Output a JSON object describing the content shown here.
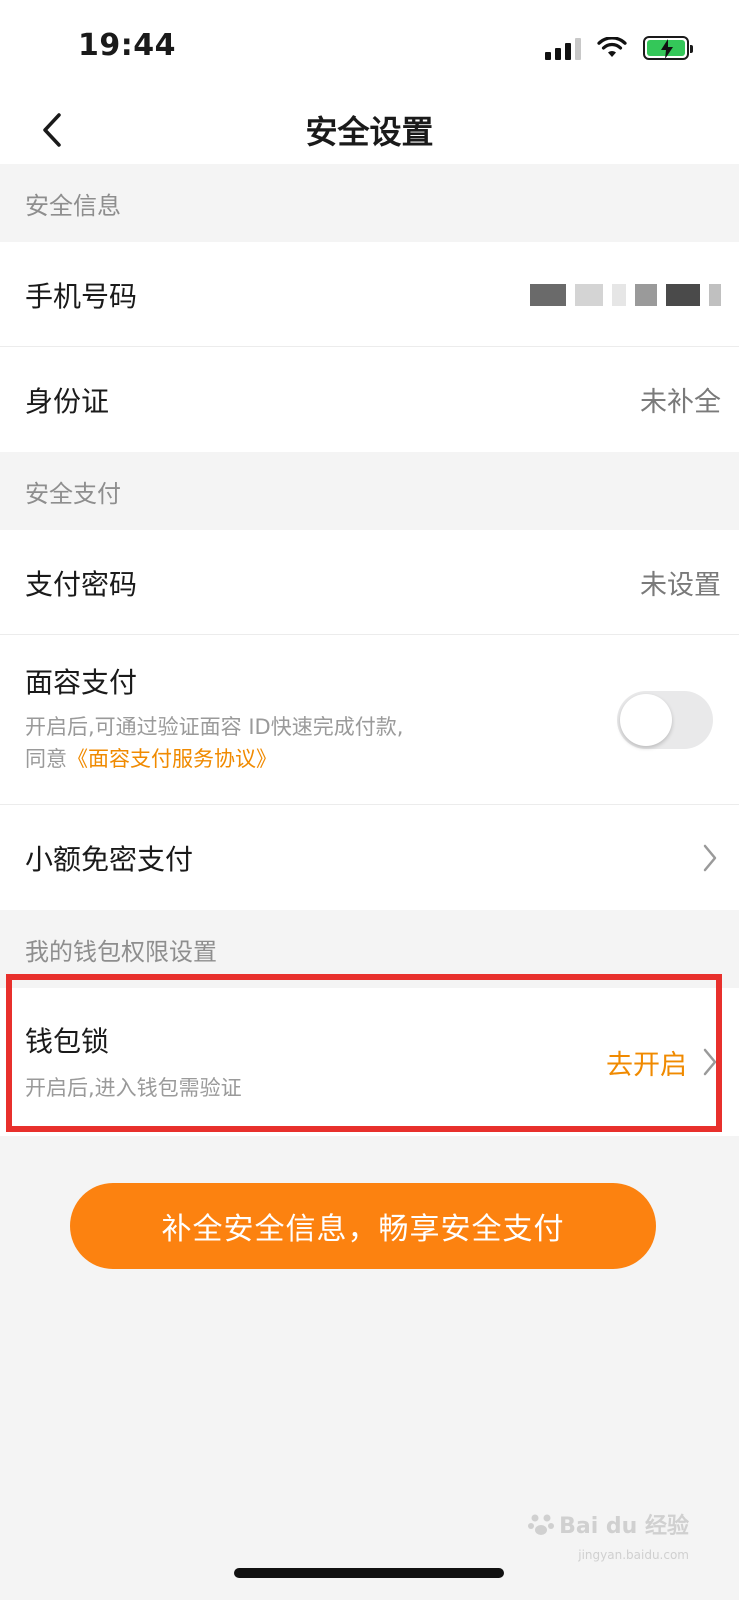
{
  "status_bar": {
    "time": "19:44",
    "icons": [
      "cellular-signal-icon",
      "wifi-icon",
      "battery-charging-icon"
    ],
    "battery_color": "#34c759"
  },
  "nav": {
    "title": "安全设置",
    "back_icon": "chevron-left-icon"
  },
  "sections": {
    "security_info": {
      "header": "安全信息",
      "phone": {
        "label": "手机号码"
      },
      "id_card": {
        "label": "身份证",
        "value": "未补全"
      }
    },
    "security_pay": {
      "header": "安全支付",
      "pay_password": {
        "label": "支付密码",
        "value": "未设置"
      },
      "face_pay": {
        "label": "面容支付",
        "desc_line1": "开启后,可通过验证面容 ID快速完成付款,",
        "desc_prefix": "同意",
        "agreement_link": "《面容支付服务协议》",
        "toggle_on": false
      },
      "small_pay": {
        "label": "小额免密支付"
      }
    },
    "wallet_permissions": {
      "header": "我的钱包权限设置",
      "wallet_lock": {
        "label": "钱包锁",
        "desc": "开启后,进入钱包需验证",
        "action": "去开启"
      }
    }
  },
  "cta_button": {
    "label": "补全安全信息，畅享安全支付"
  },
  "watermark": {
    "brand": "Bai du 经验",
    "url": "jingyan.baidu.com"
  },
  "colors": {
    "accent": "#f08a00",
    "cta": "#fc8210",
    "highlight_border": "#e8302c",
    "background": "#f4f4f4"
  }
}
